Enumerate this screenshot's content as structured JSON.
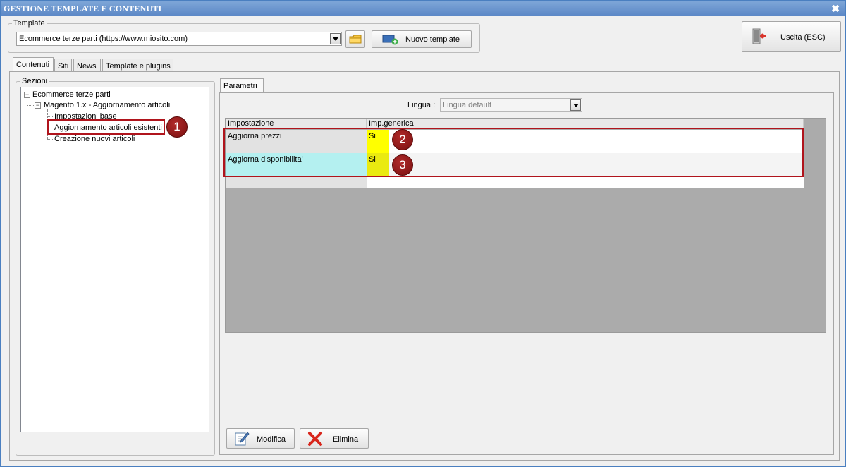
{
  "window": {
    "title": "GESTIONE TEMPLATE E CONTENUTI",
    "close_glyph": "✖"
  },
  "template_group": {
    "label": "Template",
    "combo_value": "Ecommerce terze parti (https://www.miosito.com)",
    "new_button_label": "Nuovo template"
  },
  "exit_button_label": "Uscita (ESC)",
  "main_tabs": [
    "Contenuti",
    "Siti",
    "News",
    "Template e plugins"
  ],
  "sections": {
    "label": "Sezioni",
    "tree": {
      "root": "Ecommerce terze parti",
      "child": "Magento 1.x - Aggiornamento articoli",
      "leaves": [
        "Impostazioni base",
        "Aggiornamento articoli esistenti",
        "Creazione nuovi articoli"
      ]
    }
  },
  "right_tabs": [
    "Parametri"
  ],
  "lingua": {
    "label": "Lingua :",
    "value": "Lingua default"
  },
  "grid": {
    "columns": [
      "Impostazione",
      "Imp.generica"
    ],
    "rows": [
      {
        "setting": "Aggiorna prezzi",
        "value": "Si"
      },
      {
        "setting": "Aggiorna disponibilita'",
        "value": "Si"
      }
    ]
  },
  "callouts": [
    "1",
    "2",
    "3"
  ],
  "buttons": {
    "modify": "Modifica",
    "delete": "Elimina"
  },
  "colors": {
    "title_bar": "#6b95cf",
    "yellow_cell": "#ffff00",
    "cyan_cell": "#b4f0f0",
    "highlight_border": "#b0141c",
    "callout": "#8b1a1a"
  },
  "icons": {
    "close": "close-icon",
    "folder": "folder-icon",
    "new_template": "new-template-icon",
    "exit": "exit-icon",
    "edit": "edit-icon",
    "delete": "delete-icon"
  }
}
